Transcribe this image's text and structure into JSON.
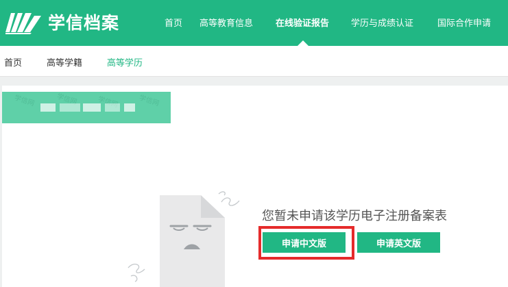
{
  "header": {
    "logo_text": "学信档案",
    "nav": [
      {
        "label": "首页",
        "active": false
      },
      {
        "label": "高等教育信息",
        "active": false
      },
      {
        "label": "在线验证报告",
        "active": true
      },
      {
        "label": "学历与成绩认证",
        "active": false
      },
      {
        "label": "国际合作申请",
        "active": false
      }
    ]
  },
  "subnav": {
    "items": [
      {
        "label": "首页",
        "active": false
      },
      {
        "label": "高等学籍",
        "active": false
      },
      {
        "label": "高等学历",
        "active": true
      }
    ]
  },
  "main": {
    "empty_message": "您暂未申请该学历电子注册备案表",
    "buttons": {
      "apply_chinese": "申请中文版",
      "apply_english": "申请英文版"
    }
  },
  "colors": {
    "brand_green": "#21b784",
    "banner_green": "#5fd0a8",
    "highlight_red": "#e52b2b"
  },
  "icons": [
    "logo-book-icon",
    "empty-document-icon"
  ]
}
